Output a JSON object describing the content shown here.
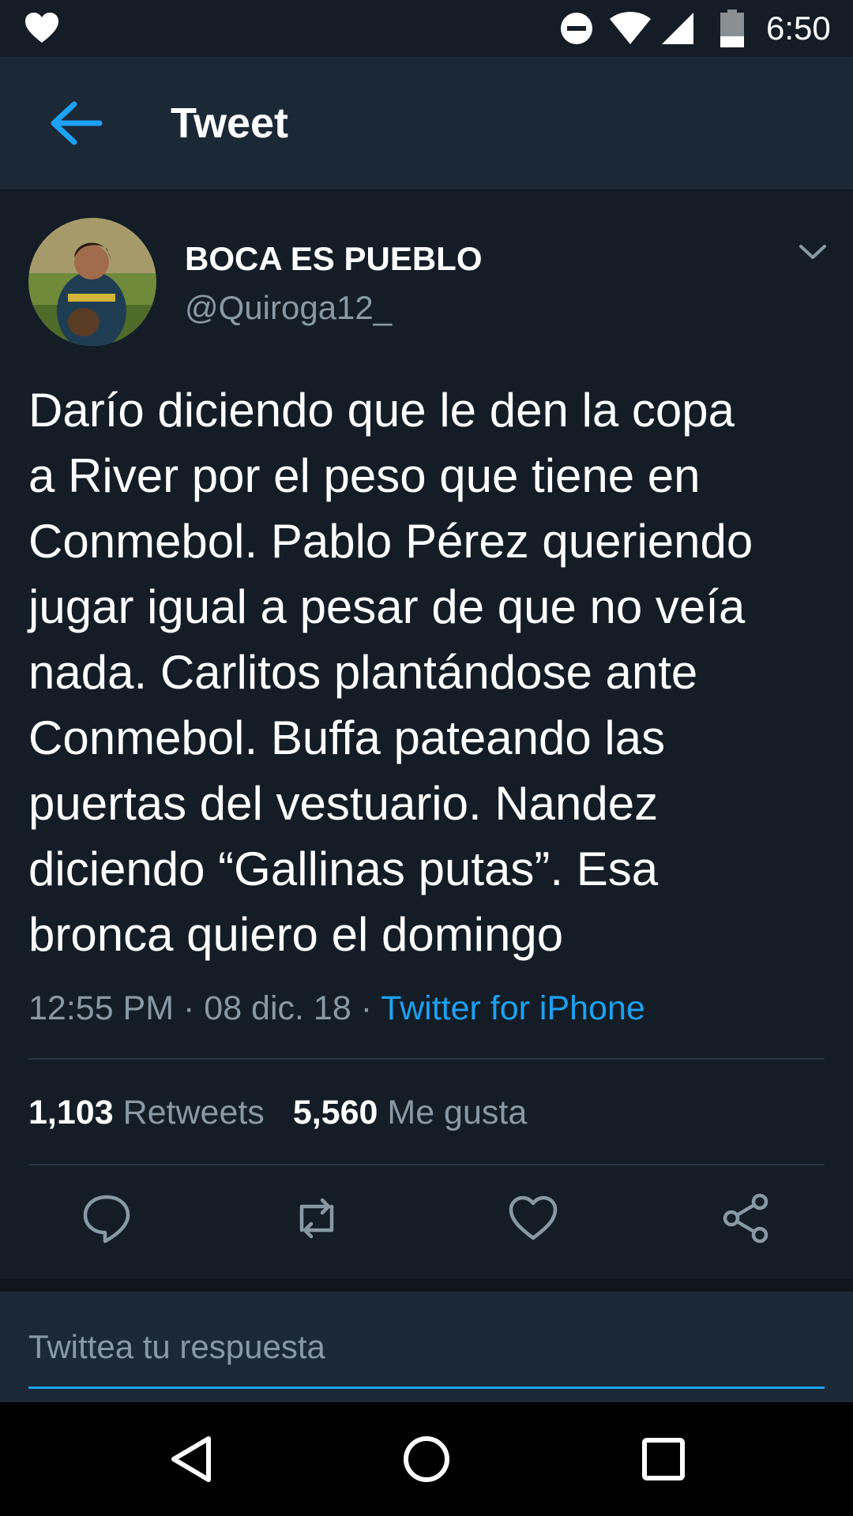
{
  "status_bar": {
    "time": "6:50",
    "icons": [
      "heart-icon",
      "do-not-disturb-icon",
      "wifi-icon",
      "cell-signal-icon",
      "battery-icon"
    ]
  },
  "header": {
    "title": "Tweet",
    "back_icon": "arrow-left-icon"
  },
  "tweet": {
    "display_name": "BOCA ES PUEBLO",
    "handle": "@Quiroga12_",
    "text_lines": [
      "Darío diciendo que le den la copa",
      "a River por el peso que tiene en",
      "Conmebol. Pablo Pérez queriendo",
      "jugar igual a pesar de que no veía",
      "nada. Carlitos plantándose ante",
      "Conmebol. Buffa pateando las",
      "puertas del vestuario. Nandez",
      "diciendo “Gallinas putas”. Esa",
      "bronca quiero el domingo"
    ],
    "time": "12:55 PM",
    "date": "08 dic. 18",
    "separator": " · ",
    "source": "Twitter for iPhone",
    "retweets_count": "1,103",
    "retweets_label": "Retweets",
    "likes_count": "5,560",
    "likes_label": "Me gusta"
  },
  "actions": [
    "reply-icon",
    "retweet-icon",
    "like-icon",
    "share-icon"
  ],
  "reply": {
    "placeholder": "Twittea tu respuesta"
  },
  "colors": {
    "background": "#141d26",
    "header_bg": "#1b2836",
    "accent": "#1da1f2",
    "secondary_text": "#8899a6"
  }
}
